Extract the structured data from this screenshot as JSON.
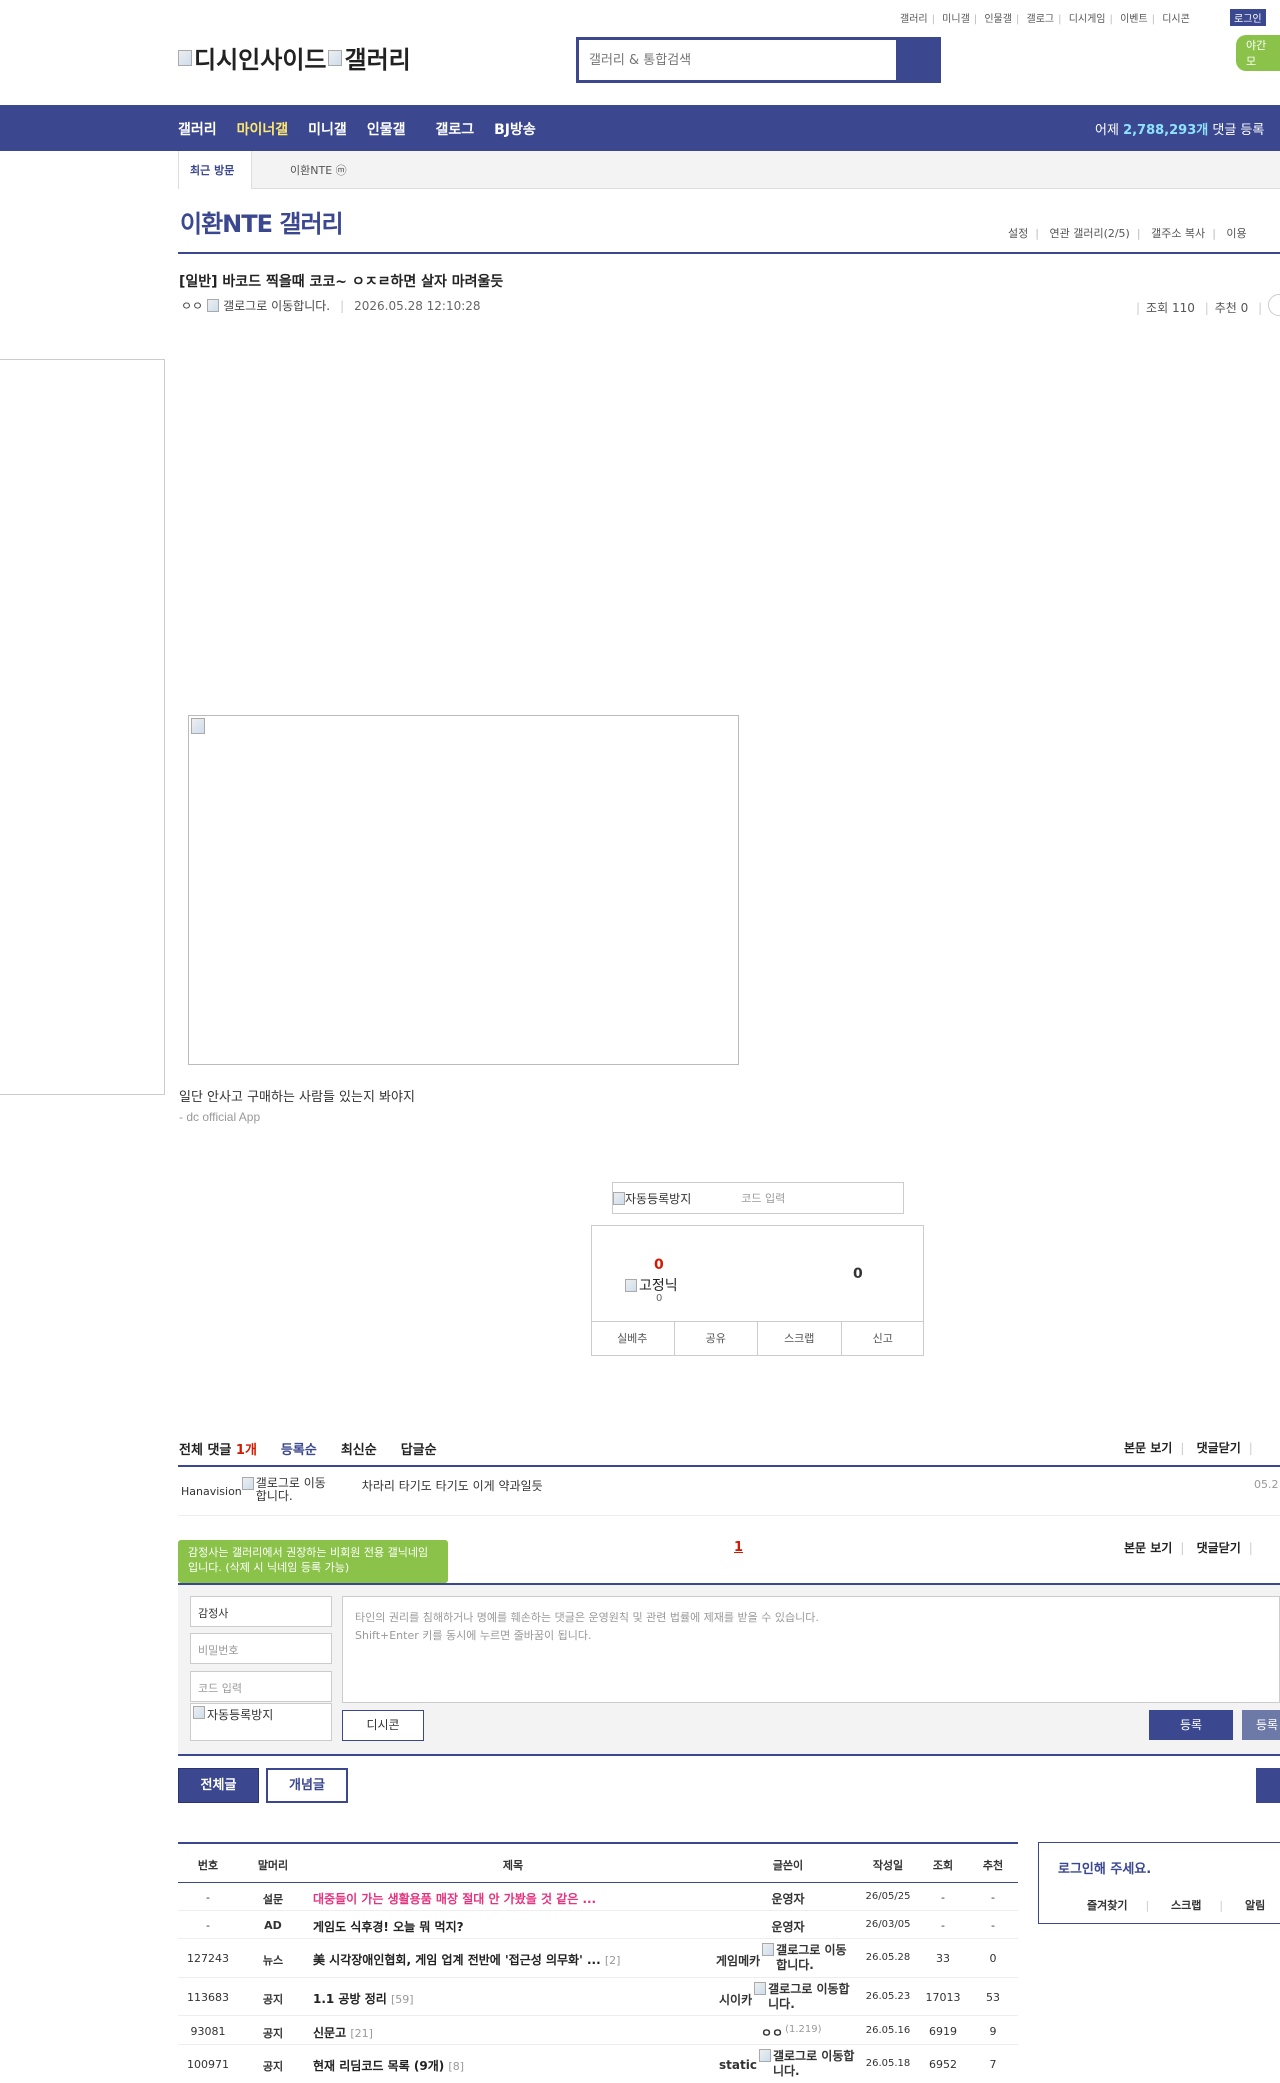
{
  "util": {
    "links": [
      "갤러리",
      "미니갤",
      "인물갤",
      "갤로그",
      "디시게임",
      "이벤트",
      "디시콘"
    ],
    "login": "로그인",
    "night": "야간 모"
  },
  "logo": {
    "alt1": "디시인사이드",
    "alt2": "갤러리"
  },
  "search": {
    "placeholder": "갤러리 & 통합검색"
  },
  "nav": {
    "items": [
      "갤러리",
      "마이너갤",
      "미니갤",
      "인물갤",
      "갤로그",
      "BJ방송"
    ],
    "yesterday_prefix": "어제",
    "yesterday_count": "2,788,293개",
    "yesterday_suffix": "댓글 등록"
  },
  "visit": {
    "tab": "최근 방문",
    "item": "이환NTE ⓜ"
  },
  "gallery": {
    "title": "이환NTE 갤러리",
    "links": [
      "설정",
      "연관 갤러리(2/5)",
      "갤주소 복사",
      "이용"
    ]
  },
  "post": {
    "title": "[일반] 바코드 찍을때 코코~ ㅇㅈㄹ하면 살자 마려울듯",
    "writer": "ㅇㅇ",
    "gallog_alt": "갤로그로 이동합니다.",
    "date": "2026.05.28 12:10:28",
    "views": "조회 110",
    "recommend": "추천 0",
    "body": "일단 안사고 구매하는 사람들 있는지 봐야지",
    "sub": "- dc official App"
  },
  "captcha": {
    "alt": "자동등록방지",
    "placeholder": "코드 입력"
  },
  "recommend_box": {
    "up": "0",
    "fix_alt": "고정닉",
    "fix_count": "0",
    "down": "0",
    "actions": [
      "실베추",
      "공유",
      "스크랩",
      "신고"
    ]
  },
  "comments": {
    "label": "전체 댓글",
    "count": "1개",
    "sorts": [
      "등록순",
      "최신순",
      "답글순"
    ],
    "view_body": "본문 보기",
    "close": "댓글닫기",
    "rows": [
      {
        "nick": "Hanavision",
        "gallog_alt": "갤로그로 이동합니다.",
        "text": "차라리 타기도 타기도 이게 약과일듯",
        "date": "05.2"
      }
    ],
    "page": "1"
  },
  "write": {
    "tooltip": "감정사는 갤러리에서 권장하는 비회원 전용 갤닉네임입니다. (삭제 시 닉네임 등록 가능)",
    "nick": "감정사",
    "pw_placeholder": "비밀번호",
    "code_placeholder": "코드 입력",
    "captcha_alt": "자동등록방지",
    "textarea_line1": "타인의 권리를 침해하거나 명예를 훼손하는 댓글은 운영원칙 및 관련 법률에 제재를 받을 수 있습니다.",
    "textarea_line2": "Shift+Enter 키를 동시에 누르면 줄바꿈이 됩니다.",
    "dccon": "디시콘",
    "submit": "등록",
    "submit2": "등록"
  },
  "tabs": {
    "all": "전체글",
    "concept": "개념글"
  },
  "list": {
    "headers": [
      "번호",
      "말머리",
      "제목",
      "글쓴이",
      "작성일",
      "조회",
      "추천"
    ],
    "rows": [
      {
        "num": "-",
        "head": "설문",
        "subject": "대중들이 가는 생활용품 매장 절대 안 가봤을 것 같은 ...",
        "reply": "",
        "writer": "운영자",
        "ip": "",
        "gallog": "",
        "date": "26/05/25",
        "views": "-",
        "rec": "-",
        "hot": true
      },
      {
        "num": "-",
        "head": "AD",
        "subject": "게임도 식후경! 오늘 뭐 먹지?",
        "reply": "",
        "writer": "운영자",
        "ip": "",
        "gallog": "",
        "date": "26/03/05",
        "views": "-",
        "rec": "-",
        "hot": false
      },
      {
        "num": "127243",
        "head": "뉴스",
        "subject": "美 시각장애인협회, 게임 업계 전반에 '접근성 의무화' ...",
        "reply": "[2]",
        "writer": "게임메카",
        "ip": "",
        "gallog": "갤로그로 이동합니다.",
        "date": "26.05.28",
        "views": "33",
        "rec": "0",
        "hot": false
      },
      {
        "num": "113683",
        "head": "공지",
        "subject": "1.1 공방 정리",
        "reply": "[59]",
        "writer": "시이카",
        "ip": "",
        "gallog": "갤로그로 이동합니다.",
        "date": "26.05.23",
        "views": "17013",
        "rec": "53",
        "hot": false
      },
      {
        "num": "93081",
        "head": "공지",
        "subject": "신문고",
        "reply": "[21]",
        "writer": "ㅇㅇ",
        "ip": "(1.219)",
        "gallog": "",
        "date": "26.05.16",
        "views": "6919",
        "rec": "9",
        "hot": false
      },
      {
        "num": "100971",
        "head": "공지",
        "subject": "현재 리딤코드 목록 (9개)",
        "reply": "[8]",
        "writer": "static",
        "ip": "",
        "gallog": "갤로그로 이동합니다.",
        "date": "26.05.18",
        "views": "6952",
        "rec": "7",
        "hot": false
      }
    ]
  },
  "login_side": {
    "title": "로그인해 주세요.",
    "links": [
      "즐겨찾기",
      "스크랩",
      "알림"
    ]
  },
  "colors": {
    "brand": "#3b4890",
    "accent_yellow": "#ffe86d",
    "green": "#8bc34a",
    "red": "#d31900",
    "hot_pink": "#e4337f"
  }
}
